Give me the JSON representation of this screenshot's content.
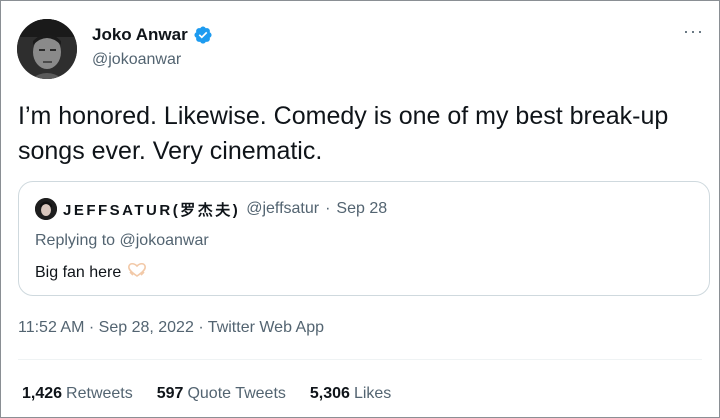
{
  "author": {
    "display_name": "Joko Anwar",
    "handle": "@jokoanwar",
    "verified_icon": "verified-badge-icon",
    "accent": "#1d9bf0"
  },
  "menu": {
    "more_label": "···"
  },
  "tweet": {
    "text": "I’m honored. Likewise. Comedy is one of my best break-up songs ever. Very cinematic."
  },
  "quote": {
    "display_name": "JEFFSATUR(罗杰夫)",
    "handle": "@jeffsatur",
    "separator": "·",
    "date": "Sep 28",
    "replying_to": "Replying to @jokoanwar",
    "body": "Big fan here",
    "emoji_icon": "heart-hands-icon"
  },
  "meta": {
    "time": "11:52 AM",
    "separator": "·",
    "date": "Sep 28, 2022",
    "source": "Twitter Web App"
  },
  "stats": [
    {
      "count": "1,426",
      "label": "Retweets"
    },
    {
      "count": "597",
      "label": "Quote Tweets"
    },
    {
      "count": "5,306",
      "label": "Likes"
    }
  ]
}
